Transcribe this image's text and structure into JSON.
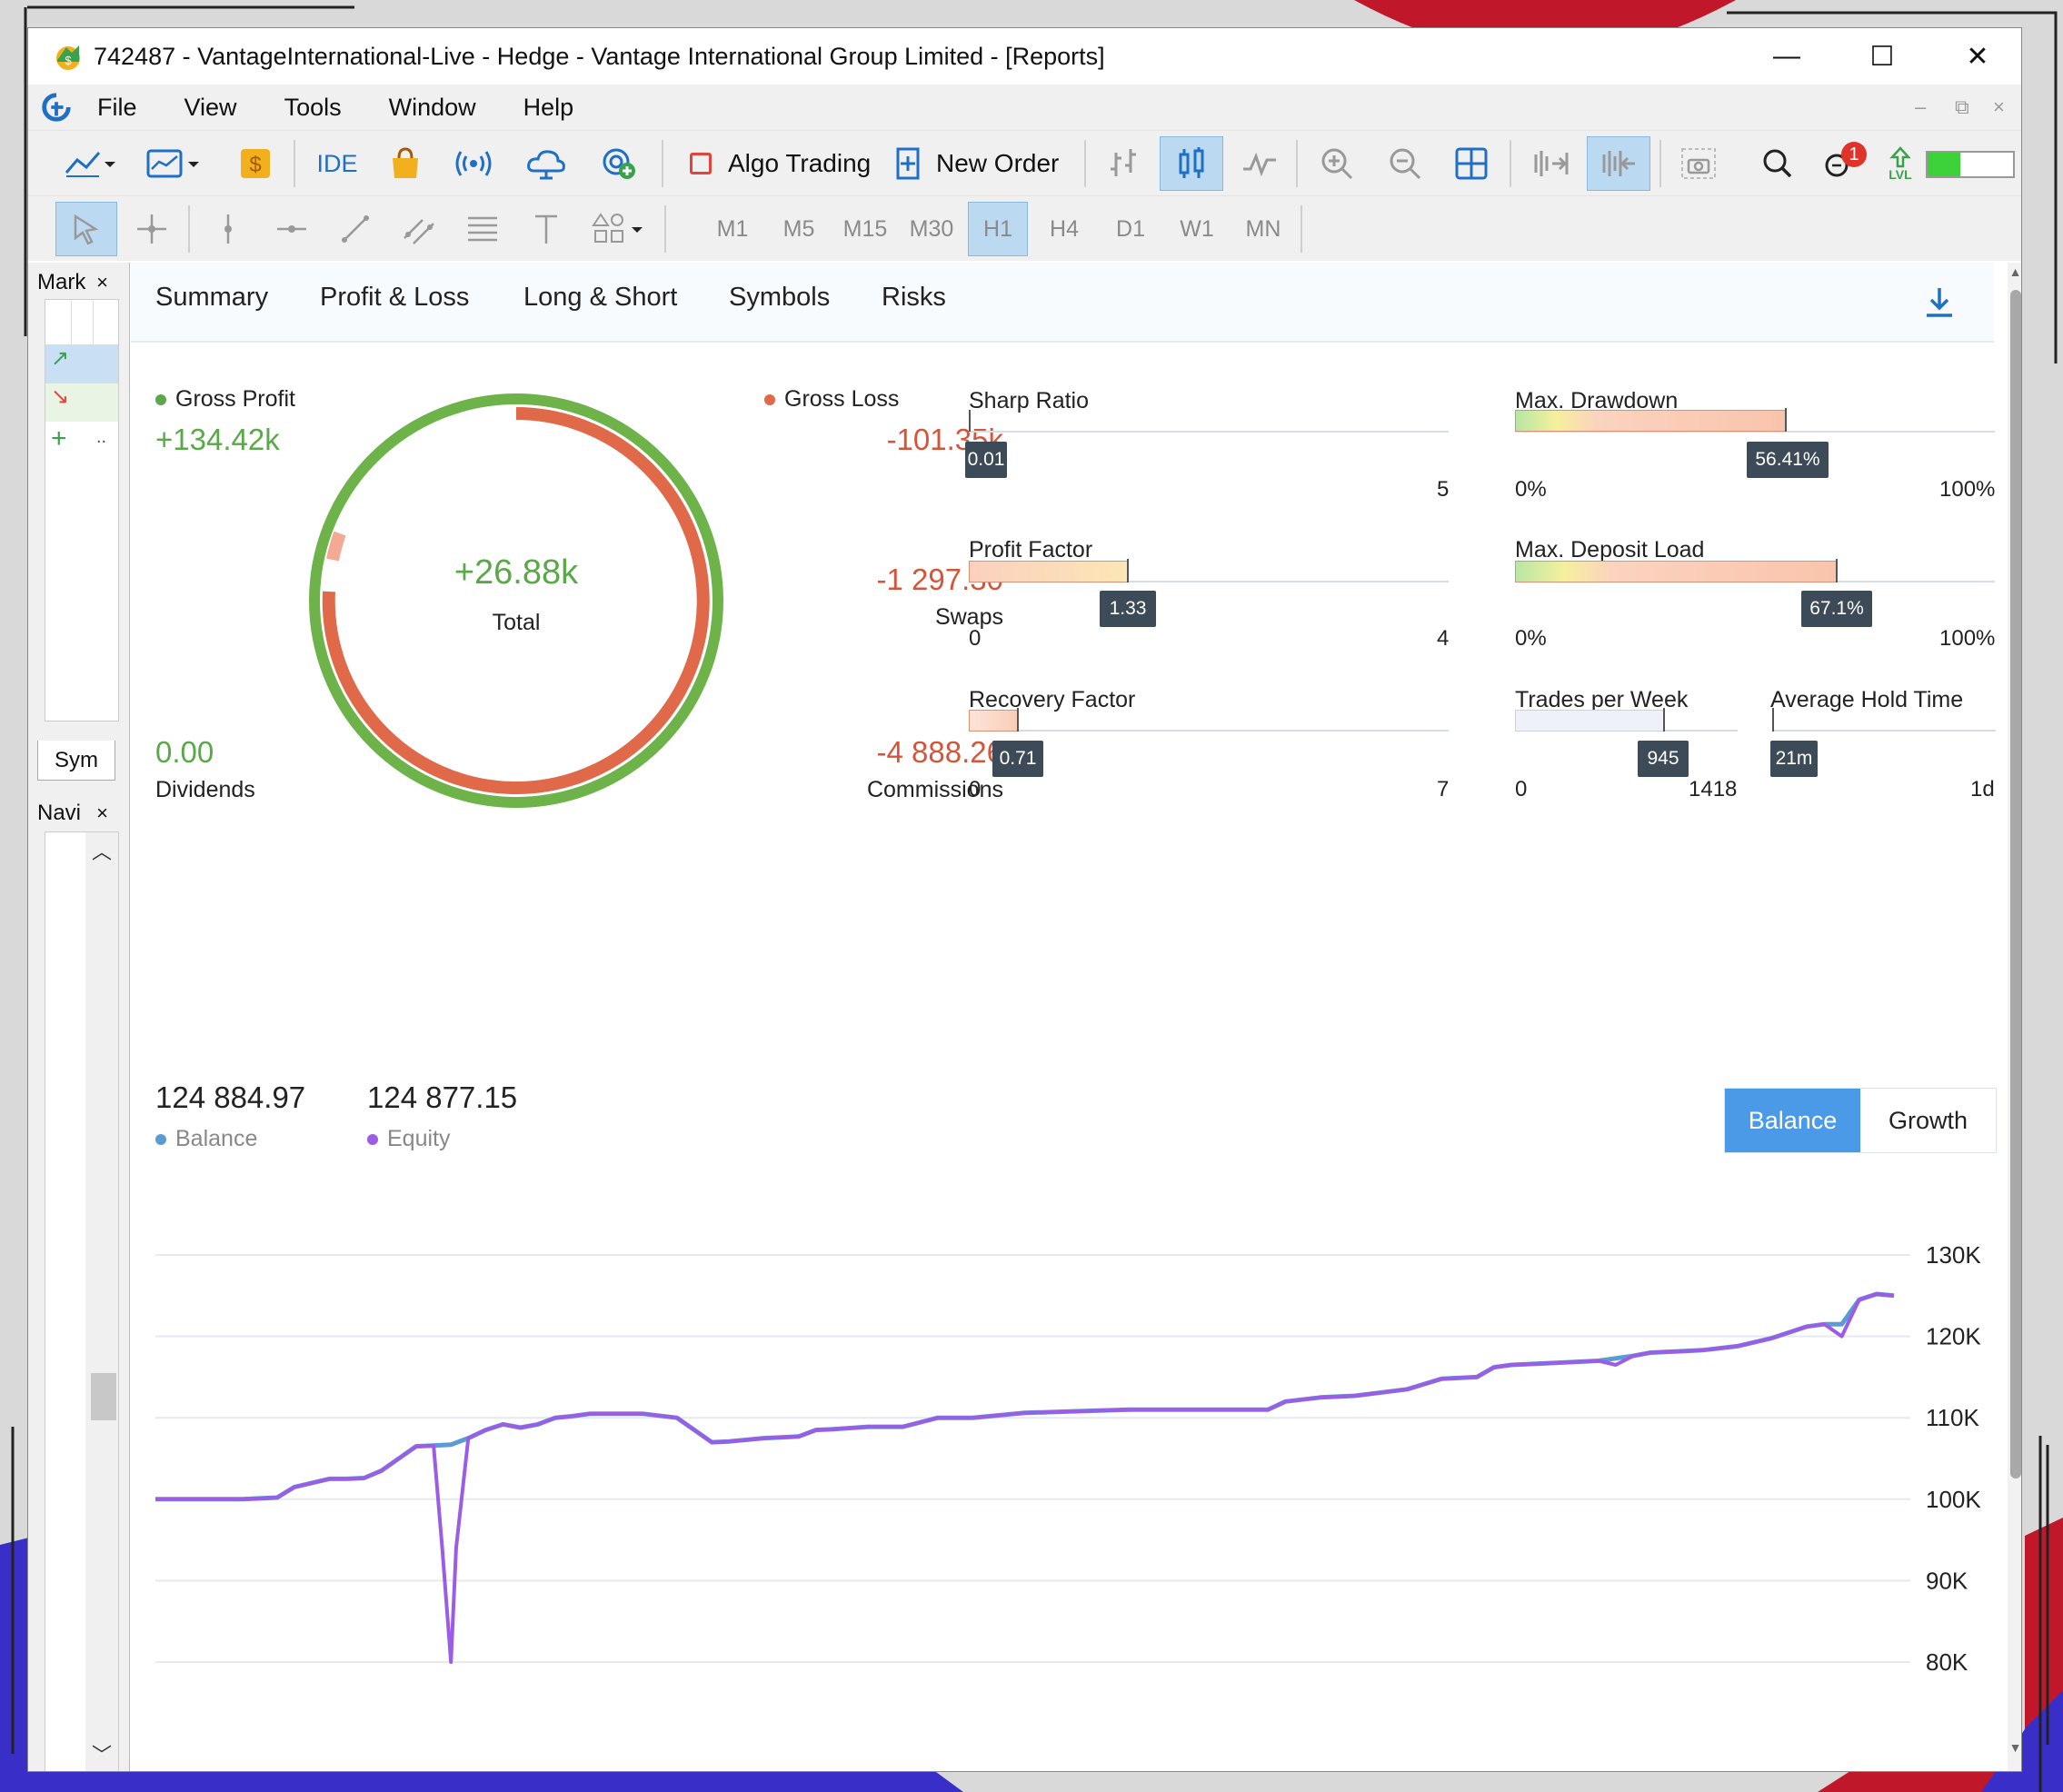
{
  "window": {
    "title": "742487 - VantageInternational-Live - Hedge - Vantage International Group Limited - [Reports]",
    "minimize": "—",
    "maximize": "☐",
    "close": "✕"
  },
  "menu": [
    "File",
    "View",
    "Tools",
    "Window",
    "Help"
  ],
  "toolbar": {
    "ide_label": "IDE",
    "algo_trading_label": "Algo Trading",
    "new_order_label": "New Order",
    "notification_count": "1",
    "lvl_label": "LVL"
  },
  "timeframes": [
    "M1",
    "M5",
    "M15",
    "M30",
    "H1",
    "H4",
    "D1",
    "W1",
    "MN"
  ],
  "selected_timeframe": "H1",
  "left_panel": {
    "market_tab": "Mark",
    "symbols_tab": "Sym",
    "navigator_tab": "Navi",
    "close_glyph": "×",
    "more": ".."
  },
  "report_tabs": [
    "Summary",
    "Profit & Loss",
    "Long & Short",
    "Symbols",
    "Risks"
  ],
  "active_tab": "Summary",
  "summary": {
    "gross_profit_label": "Gross Profit",
    "gross_profit": "+134.42k",
    "gross_loss_label": "Gross Loss",
    "gross_loss": "-101.35k",
    "total": "+26.88k",
    "total_label": "Total",
    "swaps": "-1 297.30",
    "swaps_label": "Swaps",
    "dividends": "0.00",
    "dividends_label": "Dividends",
    "commissions": "-4 888.26",
    "commissions_label": "Commissions"
  },
  "gauges": {
    "sharp_ratio": {
      "label": "Sharp Ratio",
      "value": "0.01",
      "min": "0",
      "max": "5",
      "fraction": 0.002
    },
    "profit_factor": {
      "label": "Profit Factor",
      "value": "1.33",
      "min": "0",
      "max": "4",
      "fraction": 0.3325
    },
    "recovery_factor": {
      "label": "Recovery Factor",
      "value": "0.71",
      "min": "0",
      "max": "7",
      "fraction": 0.101
    },
    "max_drawdown": {
      "label": "Max. Drawdown",
      "value": "56.41%",
      "min": "0%",
      "max": "100%",
      "fraction": 0.5641
    },
    "max_deposit_load": {
      "label": "Max. Deposit Load",
      "value": "67.1%",
      "min": "0%",
      "max": "100%",
      "fraction": 0.671
    },
    "trades_per_week": {
      "label": "Trades per Week",
      "value": "945",
      "min": "0",
      "max": "1418",
      "fraction": 0.666
    },
    "average_hold_time": {
      "label": "Average Hold Time",
      "value": "21m",
      "min": "",
      "max": "1d",
      "fraction": 0.0
    }
  },
  "balance": {
    "balance_value": "124 884.97",
    "balance_label": "Balance",
    "equity_value": "124 877.15",
    "equity_label": "Equity",
    "toggle_balance": "Balance",
    "toggle_growth": "Growth"
  },
  "colors": {
    "profit": "#5aa84a",
    "loss": "#e0694a",
    "balance_series": "#5b9bd5",
    "equity_series": "#9b5de5",
    "accent": "#4a9ae8"
  },
  "chart_data": {
    "type": "line",
    "ylim": [
      75000,
      132000
    ],
    "yticks": [
      "130K",
      "120K",
      "110K",
      "100K",
      "90K",
      "80K"
    ],
    "ytick_values": [
      130000,
      120000,
      110000,
      100000,
      90000,
      80000
    ],
    "grid": true,
    "series": [
      {
        "name": "Balance",
        "x": [
          0,
          5,
          7,
          8,
          10,
          11,
          12,
          13,
          14,
          15,
          16,
          17,
          18,
          19,
          20,
          21,
          22,
          23,
          24,
          25,
          26,
          28,
          30,
          32,
          33,
          35,
          36,
          37,
          38,
          39,
          41,
          43,
          45,
          47,
          50,
          53,
          56,
          60,
          64,
          65,
          67,
          69,
          72,
          74,
          76,
          77,
          78,
          80,
          83,
          85,
          86,
          88,
          89,
          91,
          93,
          95,
          96,
          97,
          98,
          99,
          100
        ],
        "values": [
          100000,
          100000,
          100200,
          101500,
          102500,
          102500,
          102600,
          103500,
          105000,
          106500,
          106600,
          106700,
          107500,
          108500,
          109200,
          108800,
          109200,
          110000,
          110200,
          110500,
          110500,
          110500,
          110000,
          107000,
          107100,
          107500,
          107600,
          107700,
          108500,
          108600,
          108900,
          108900,
          110000,
          110000,
          110600,
          110800,
          111000,
          111000,
          111000,
          112000,
          112500,
          112700,
          113500,
          114800,
          115000,
          116200,
          116500,
          116700,
          117000,
          117600,
          118000,
          118200,
          118300,
          118800,
          119800,
          121200,
          121500,
          121500,
          124500,
          125200,
          125000
        ]
      },
      {
        "name": "Equity",
        "x": [
          0,
          5,
          7,
          8,
          10,
          11,
          12,
          13,
          14,
          15,
          16,
          16.5,
          17,
          17.3,
          18,
          19,
          20,
          21,
          22,
          23,
          24,
          25,
          26,
          28,
          30,
          32,
          33,
          35,
          36,
          37,
          38,
          39,
          41,
          43,
          45,
          47,
          50,
          53,
          56,
          60,
          64,
          65,
          67,
          69,
          72,
          74,
          76,
          77,
          78,
          80,
          82,
          83,
          84,
          85,
          86,
          88,
          89,
          91,
          93,
          95,
          96,
          97,
          98,
          99,
          100
        ],
        "values": [
          100000,
          100000,
          100200,
          101500,
          102500,
          102500,
          102600,
          103500,
          105000,
          106500,
          106600,
          94000,
          80000,
          94000,
          107500,
          108500,
          109200,
          108800,
          109200,
          110000,
          110200,
          110500,
          110500,
          110500,
          110000,
          107000,
          107100,
          107500,
          107600,
          107700,
          108500,
          108600,
          108900,
          108900,
          110000,
          110000,
          110600,
          110800,
          111000,
          111000,
          111000,
          112000,
          112500,
          112700,
          113500,
          114800,
          115000,
          116200,
          116500,
          116700,
          116900,
          117000,
          116500,
          117600,
          118000,
          118200,
          118300,
          118800,
          119800,
          121200,
          121500,
          120000,
          124500,
          125200,
          125000
        ]
      }
    ]
  }
}
